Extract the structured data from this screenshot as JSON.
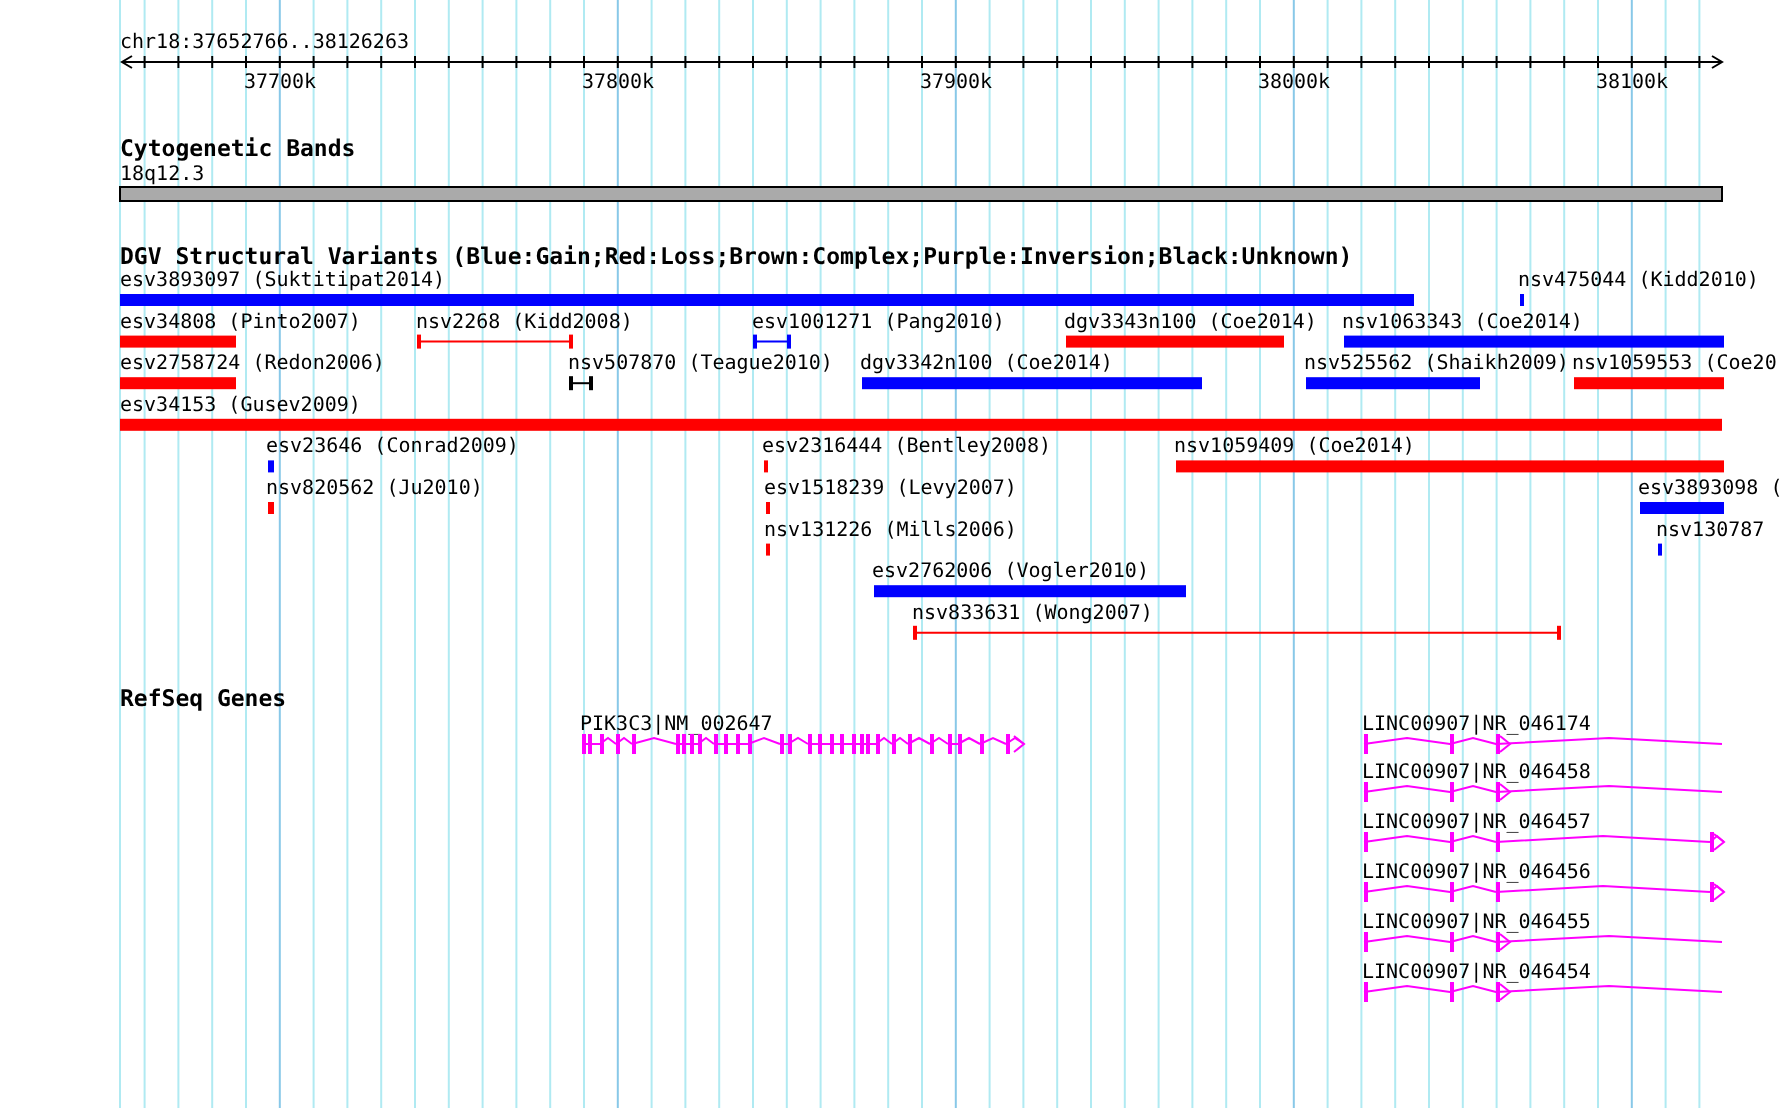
{
  "ruler": {
    "region": "chr18:37652766..38126263",
    "ticks": [
      "37700k",
      "37800k",
      "37900k",
      "38000k",
      "38100k"
    ]
  },
  "cytogenetic_bands": {
    "title": "Cytogenetic Bands",
    "band": "18q12.3"
  },
  "structural_variants": {
    "title": "DGV Structural Variants (Blue:Gain;Red:Loss;Brown:Complex;Purple:Inversion;Black:Unknown)",
    "features": [
      {
        "label": "esv3893097 (Suktitipat2014)",
        "color": "#0000ff",
        "kind": "bar"
      },
      {
        "label": "nsv475044 (Kidd2010)",
        "color": "#0000ff",
        "kind": "bar"
      },
      {
        "label": "esv34808 (Pinto2007)",
        "color": "#ff0000",
        "kind": "bar"
      },
      {
        "label": "nsv2268 (Kidd2008)",
        "color": "#ff0000",
        "kind": "span"
      },
      {
        "label": "esv1001271 (Pang2010)",
        "color": "#0000ff",
        "kind": "span"
      },
      {
        "label": "dgv3343n100 (Coe2014)",
        "color": "#ff0000",
        "kind": "bar"
      },
      {
        "label": "nsv1063343 (Coe2014)",
        "color": "#0000ff",
        "kind": "bar"
      },
      {
        "label": "esv2758724 (Redon2006)",
        "color": "#ff0000",
        "kind": "bar"
      },
      {
        "label": "nsv507870 (Teague2010)",
        "color": "#000000",
        "kind": "span"
      },
      {
        "label": "dgv3342n100 (Coe2014)",
        "color": "#0000ff",
        "kind": "bar"
      },
      {
        "label": "nsv525562 (Shaikh2009)",
        "color": "#0000ff",
        "kind": "bar"
      },
      {
        "label": "nsv1059553 (Coe20",
        "color": "#ff0000",
        "kind": "bar"
      },
      {
        "label": "esv34153 (Gusev2009)",
        "color": "#ff0000",
        "kind": "bar"
      },
      {
        "label": "esv23646 (Conrad2009)",
        "color": "#0000ff",
        "kind": "bar"
      },
      {
        "label": "esv2316444 (Bentley2008)",
        "color": "#ff0000",
        "kind": "bar"
      },
      {
        "label": "nsv1059409 (Coe2014)",
        "color": "#ff0000",
        "kind": "bar"
      },
      {
        "label": "nsv820562 (Ju2010)",
        "color": "#ff0000",
        "kind": "bar"
      },
      {
        "label": "esv1518239 (Levy2007)",
        "color": "#ff0000",
        "kind": "bar"
      },
      {
        "label": "esv3893098 (",
        "color": "#0000ff",
        "kind": "bar"
      },
      {
        "label": "nsv131226 (Mills2006)",
        "color": "#ff0000",
        "kind": "bar"
      },
      {
        "label": "nsv130787",
        "color": "#0000ff",
        "kind": "bar"
      },
      {
        "label": "esv2762006 (Vogler2010)",
        "color": "#0000ff",
        "kind": "bar"
      },
      {
        "label": "nsv833631 (Wong2007)",
        "color": "#ff0000",
        "kind": "span"
      }
    ]
  },
  "refseq_genes": {
    "title": "RefSeq Genes",
    "genes": [
      {
        "label": "PIK3C3|NM_002647"
      },
      {
        "label": "LINC00907|NR_046174"
      },
      {
        "label": "LINC00907|NR_046458"
      },
      {
        "label": "LINC00907|NR_046457"
      },
      {
        "label": "LINC00907|NR_046456"
      },
      {
        "label": "LINC00907|NR_046455"
      },
      {
        "label": "LINC00907|NR_046454"
      }
    ]
  }
}
